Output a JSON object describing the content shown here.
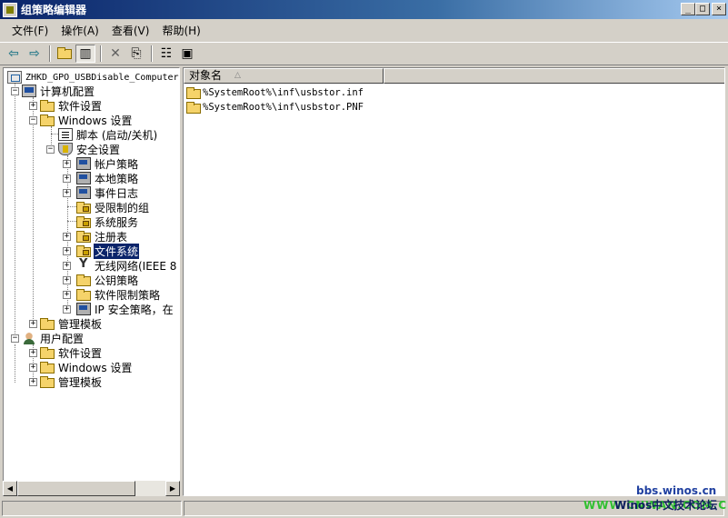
{
  "window": {
    "title": "组策略编辑器",
    "controls": {
      "minimize": "_",
      "maximize": "□",
      "close": "×"
    }
  },
  "menubar": {
    "items": [
      "文件(F)",
      "操作(A)",
      "查看(V)",
      "帮助(H)"
    ]
  },
  "toolbar": {
    "buttons": [
      "back-arrow-icon",
      "forward-arrow-icon",
      "up-folder-icon",
      "show-hide-tree-icon",
      "delete-icon",
      "export-list-icon",
      "properties-icon",
      "help-icon"
    ]
  },
  "tree": {
    "nodes": [
      {
        "label": "ZHKD_GPO_USBDisable_Computer",
        "icon": "gpo"
      },
      {
        "label": "计算机配置",
        "icon": "computer"
      },
      {
        "label": "软件设置",
        "icon": "folder"
      },
      {
        "label": "Windows 设置",
        "icon": "folder"
      },
      {
        "label": "脚本 (启动/关机)",
        "icon": "script"
      },
      {
        "label": "安全设置",
        "icon": "shield"
      },
      {
        "label": "帐户策略",
        "icon": "pcnet"
      },
      {
        "label": "本地策略",
        "icon": "pcnet"
      },
      {
        "label": "事件日志",
        "icon": "pcnet"
      },
      {
        "label": "受限制的组",
        "icon": "lockfolder"
      },
      {
        "label": "系统服务",
        "icon": "lockfolder"
      },
      {
        "label": "注册表",
        "icon": "lockfolder"
      },
      {
        "label": "文件系统",
        "icon": "lockfolder",
        "selected": true
      },
      {
        "label": "无线网络(IEEE 8",
        "icon": "antenna"
      },
      {
        "label": "公钥策略",
        "icon": "folder"
      },
      {
        "label": "软件限制策略",
        "icon": "folder"
      },
      {
        "label": "IP 安全策略，在",
        "icon": "pcnet"
      },
      {
        "label": "管理模板",
        "icon": "folder"
      },
      {
        "label": "用户配置",
        "icon": "user"
      },
      {
        "label": "软件设置",
        "icon": "folder"
      },
      {
        "label": "Windows 设置",
        "icon": "folder"
      },
      {
        "label": "管理模板",
        "icon": "folder"
      }
    ]
  },
  "list": {
    "column_header": "对象名",
    "items": [
      "%SystemRoot%\\inf\\usbstor.inf",
      "%SystemRoot%\\inf\\usbstor.PNF"
    ]
  },
  "watermark": {
    "line1": "bbs.winos.cn",
    "line2_green": "WWW.CNWAN.COM.CN",
    "line2_blue": "Winos中文技术论坛"
  }
}
